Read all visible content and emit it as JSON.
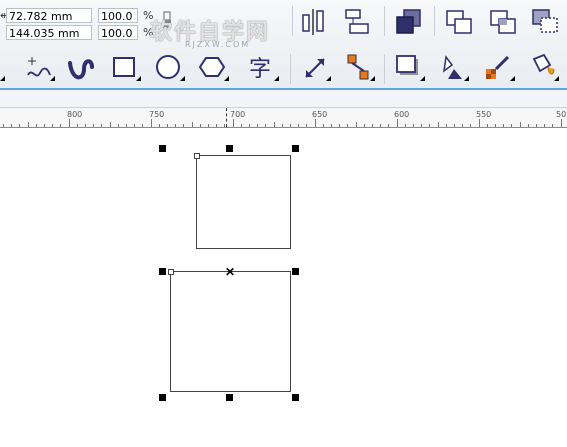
{
  "property_bar": {
    "x_label": "↔",
    "width_value": "72.782 mm",
    "height_value": "144.035 mm",
    "scale_x": "100.0",
    "scale_y": "100.0",
    "percent_symbol_1": "%",
    "percent_symbol_2": "%"
  },
  "watermark": {
    "text": "软件自学网",
    "subtext": "RJZXW.COM"
  },
  "toolbar_icons": [
    "align-distribute-icon",
    "group-icon",
    "arrange-front-icon",
    "combine-icon",
    "intersect-icon",
    "trim-icon",
    "freehand-tool-icon",
    "artistic-media-icon",
    "rectangle-tool-icon",
    "ellipse-tool-icon",
    "polygon-tool-icon",
    "text-tool-icon",
    "dimension-tool-icon",
    "connector-tool-icon",
    "drop-shadow-icon",
    "transparency-icon",
    "eyedropper-icon",
    "fill-bucket-icon"
  ],
  "ruler": {
    "labels": [
      "800",
      "750",
      "700",
      "650",
      "600",
      "550",
      "50"
    ]
  },
  "colors": {
    "accent_blue": "#5aa8de",
    "icon_dark": "#2e2f6b",
    "icon_orange": "#e8781e"
  }
}
